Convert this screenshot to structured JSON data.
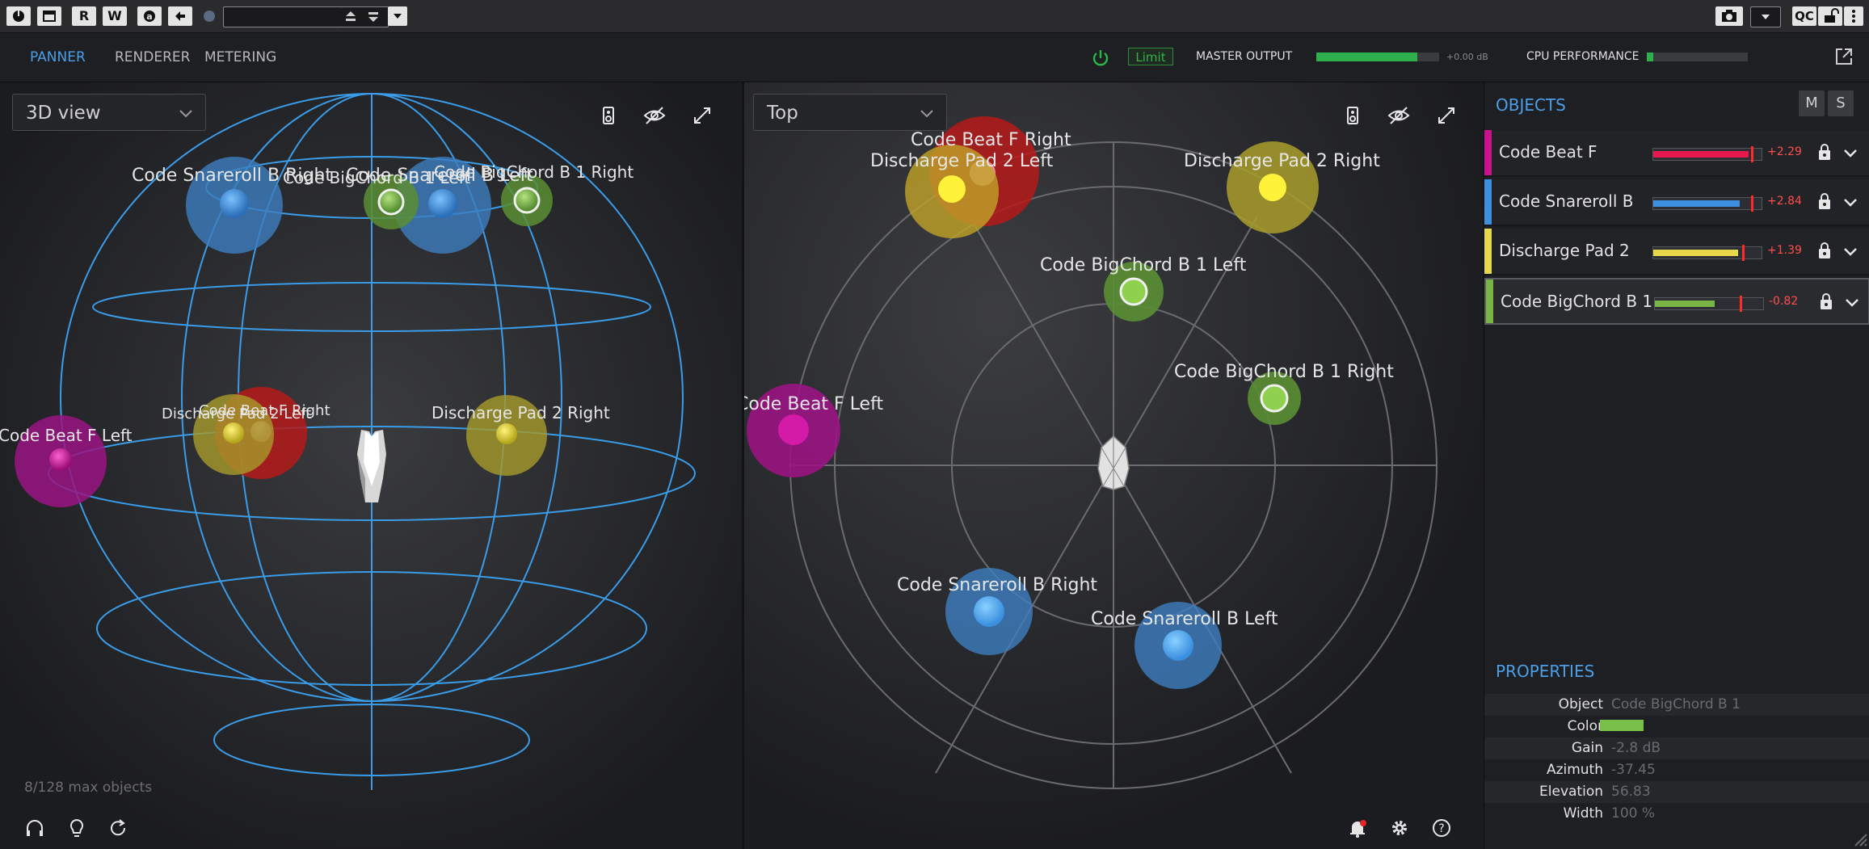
{
  "toolbar": {
    "btn_r": "R",
    "btn_w": "W",
    "btn_qc": "QC"
  },
  "nav": {
    "tabs": [
      "PANNER",
      "RENDERER",
      "METERING"
    ],
    "limit_label": "Limit",
    "master_output_label": "MASTER OUTPUT",
    "master_output_db": "+0.00 dB",
    "master_output_level": 0.82,
    "cpu_label": "CPU PERFORMANCE",
    "cpu_level": 0.06
  },
  "panel3d": {
    "view_label": "3D view",
    "object_count": "8/128 max objects",
    "labels": {
      "snare_right": "Code Snareroll B Right",
      "snare_left": "Code Snareroll B Left",
      "bigchord_left": "Code BigChord B 1 Left",
      "bigchord_right": "Code BigChord B 1 Right",
      "beat_left": "Code Beat F Left",
      "pad_left": "Discharge Pad 2 Left",
      "beat_right": "Code Beat F Right",
      "pad_right": "Discharge Pad 2 Right"
    }
  },
  "paneltop": {
    "view_label": "Top",
    "labels": {
      "beat_right": "Code Beat F Right",
      "pad_left": "Discharge Pad 2 Left",
      "pad_right": "Discharge Pad 2 Right",
      "bigchord_left": "Code BigChord B 1 Left",
      "bigchord_right": "Code BigChord B 1 Right",
      "beat_left": "Code Beat F Left",
      "snare_right": "Code Snareroll B Right",
      "snare_left": "Code Snareroll B Left"
    }
  },
  "objects": {
    "title": "OBJECTS",
    "mute_label": "M",
    "solo_label": "S",
    "rows": [
      {
        "name": "Code Beat F",
        "gain": "+2.29",
        "color": "#c8148c",
        "meter_color": "#e8174f",
        "level": 0.88,
        "peak": 0.9
      },
      {
        "name": "Code Snareroll B",
        "gain": "+2.84",
        "color": "#3d8fe0",
        "meter_color": "#3d8fe0",
        "level": 0.8,
        "peak": 0.9
      },
      {
        "name": "Discharge Pad 2",
        "gain": "+1.39",
        "color": "#e6d84a",
        "meter_color": "#e6d84a",
        "level": 0.78,
        "peak": 0.82
      },
      {
        "name": "Code BigChord B 1",
        "gain": "-0.82",
        "color": "#79b545",
        "meter_color": "#79b545",
        "level": 0.55,
        "peak": 0.78
      }
    ]
  },
  "properties": {
    "title": "PROPERTIES",
    "object_label": "Object",
    "object_value": "Code BigChord B 1",
    "color_label": "Color",
    "color_value": "#79c04a",
    "gain_label": "Gain",
    "gain_value": "-2.8 dB",
    "azimuth_label": "Azimuth",
    "azimuth_value": "-37.45",
    "elevation_label": "Elevation",
    "elevation_value": "56.83",
    "width_label": "Width",
    "width_value": "100 %"
  }
}
